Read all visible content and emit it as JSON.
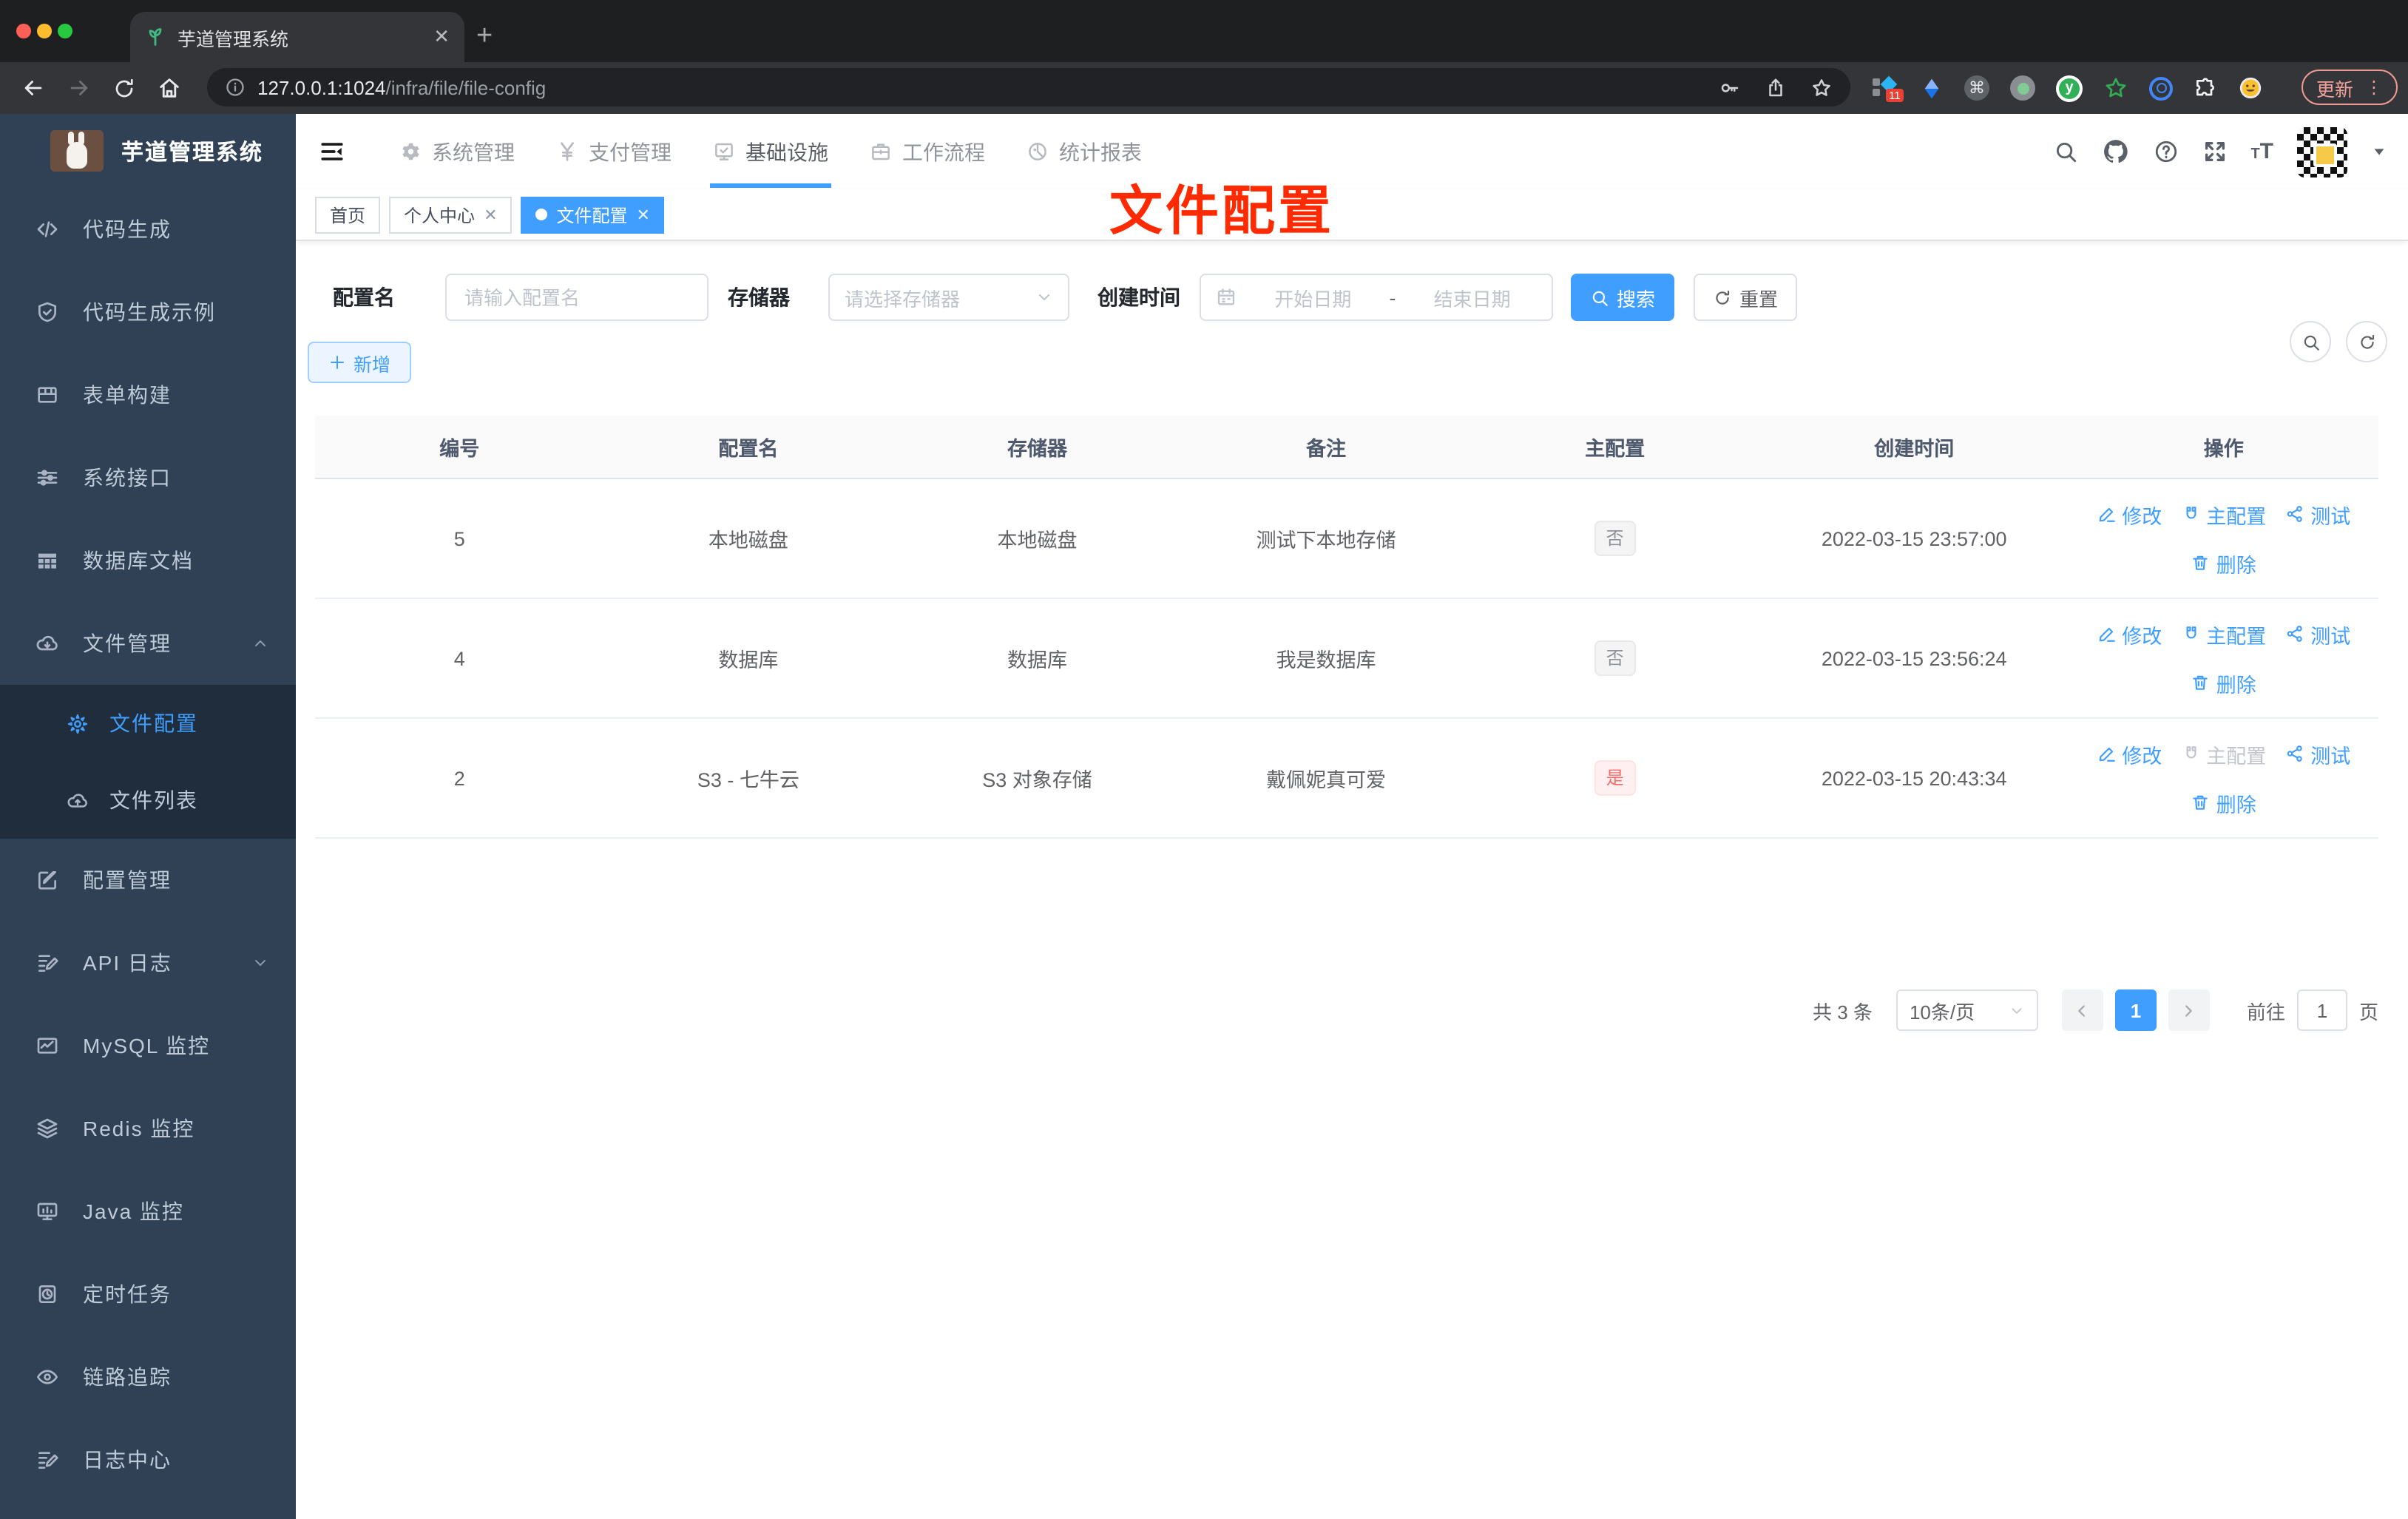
{
  "colors": {
    "accent": "#409eff",
    "danger": "#f56c6c",
    "sidebar_bg": "#304156",
    "submenu_bg": "#1f2d3d",
    "annotation_red": "#ff2a00",
    "tag_info_text": "#909399"
  },
  "browser": {
    "tab_title": "芋道管理系统",
    "tab_close": "✕",
    "new_tab": "+",
    "url_host": "127.0.0.1:1024",
    "url_path": "/infra/file/file-config",
    "extension_badge": "11",
    "update_button": "更新",
    "menu_dots": "⋮"
  },
  "sidebar": {
    "title": "芋道管理系统",
    "items": [
      {
        "label": "代码生成",
        "icon": "code-icon"
      },
      {
        "label": "代码生成示例",
        "icon": "shield-check-icon"
      },
      {
        "label": "表单构建",
        "icon": "form-grid-icon"
      },
      {
        "label": "系统接口",
        "icon": "sliders-icon"
      },
      {
        "label": "数据库文档",
        "icon": "table-icon"
      },
      {
        "label": "文件管理",
        "icon": "cloud-download-icon"
      }
    ],
    "submenu": [
      {
        "label": "文件配置",
        "icon": "gear-icon",
        "active": true
      },
      {
        "label": "文件列表",
        "icon": "cloud-upload-icon"
      }
    ],
    "items2": [
      {
        "label": "配置管理",
        "icon": "edit-square-icon"
      },
      {
        "label": "API 日志",
        "icon": "document-edit-icon"
      },
      {
        "label": "MySQL 监控",
        "icon": "chart-line-icon"
      },
      {
        "label": "Redis 监控",
        "icon": "layers-icon"
      },
      {
        "label": "Java 监控",
        "icon": "monitor-icon"
      },
      {
        "label": "定时任务",
        "icon": "timer-icon"
      },
      {
        "label": "链路追踪",
        "icon": "eye-icon"
      },
      {
        "label": "日志中心",
        "icon": "document-edit-icon"
      }
    ]
  },
  "header": {
    "nav": [
      {
        "label": "系统管理",
        "icon": "gear-icon"
      },
      {
        "label": "支付管理",
        "icon": "yen-icon"
      },
      {
        "label": "基础设施",
        "icon": "infra-monitor-icon",
        "active": true
      },
      {
        "label": "工作流程",
        "icon": "briefcase-icon"
      },
      {
        "label": "统计报表",
        "icon": "pie-chart-icon"
      }
    ]
  },
  "tags": {
    "home": "首页",
    "profile": "个人中心",
    "fileconfig": "文件配置",
    "close": "✕"
  },
  "annotation": {
    "text": "文件配置"
  },
  "filter": {
    "name_label": "配置名",
    "name_placeholder": "请输入配置名",
    "storage_label": "存储器",
    "storage_placeholder": "请选择存储器",
    "date_label": "创建时间",
    "date_start": "开始日期",
    "date_sep": "-",
    "date_end": "结束日期",
    "search": "搜索",
    "reset": "重置"
  },
  "toolbar": {
    "add": "新增"
  },
  "table": {
    "headers": [
      "编号",
      "配置名",
      "存储器",
      "备注",
      "主配置",
      "创建时间",
      "操作"
    ],
    "action_labels": {
      "edit": "修改",
      "primary": "主配置",
      "test": "测试",
      "del": "删除"
    },
    "rows": [
      {
        "id": "5",
        "name": "本地磁盘",
        "storage": "本地磁盘",
        "remark": "测试下本地存储",
        "primary": "否",
        "created": "2022-03-15 23:57:00"
      },
      {
        "id": "4",
        "name": "数据库",
        "storage": "数据库",
        "remark": "我是数据库",
        "primary": "否",
        "created": "2022-03-15 23:56:24"
      },
      {
        "id": "2",
        "name": "S3 - 七牛云",
        "storage": "S3 对象存储",
        "remark": "戴佩妮真可爱",
        "primary": "是",
        "created": "2022-03-15 20:43:34"
      }
    ]
  },
  "pagination": {
    "total": "共 3 条",
    "page_size": "10条/页",
    "page": "1",
    "goto_prefix": "前往",
    "goto_value": "1",
    "goto_suffix": "页"
  }
}
